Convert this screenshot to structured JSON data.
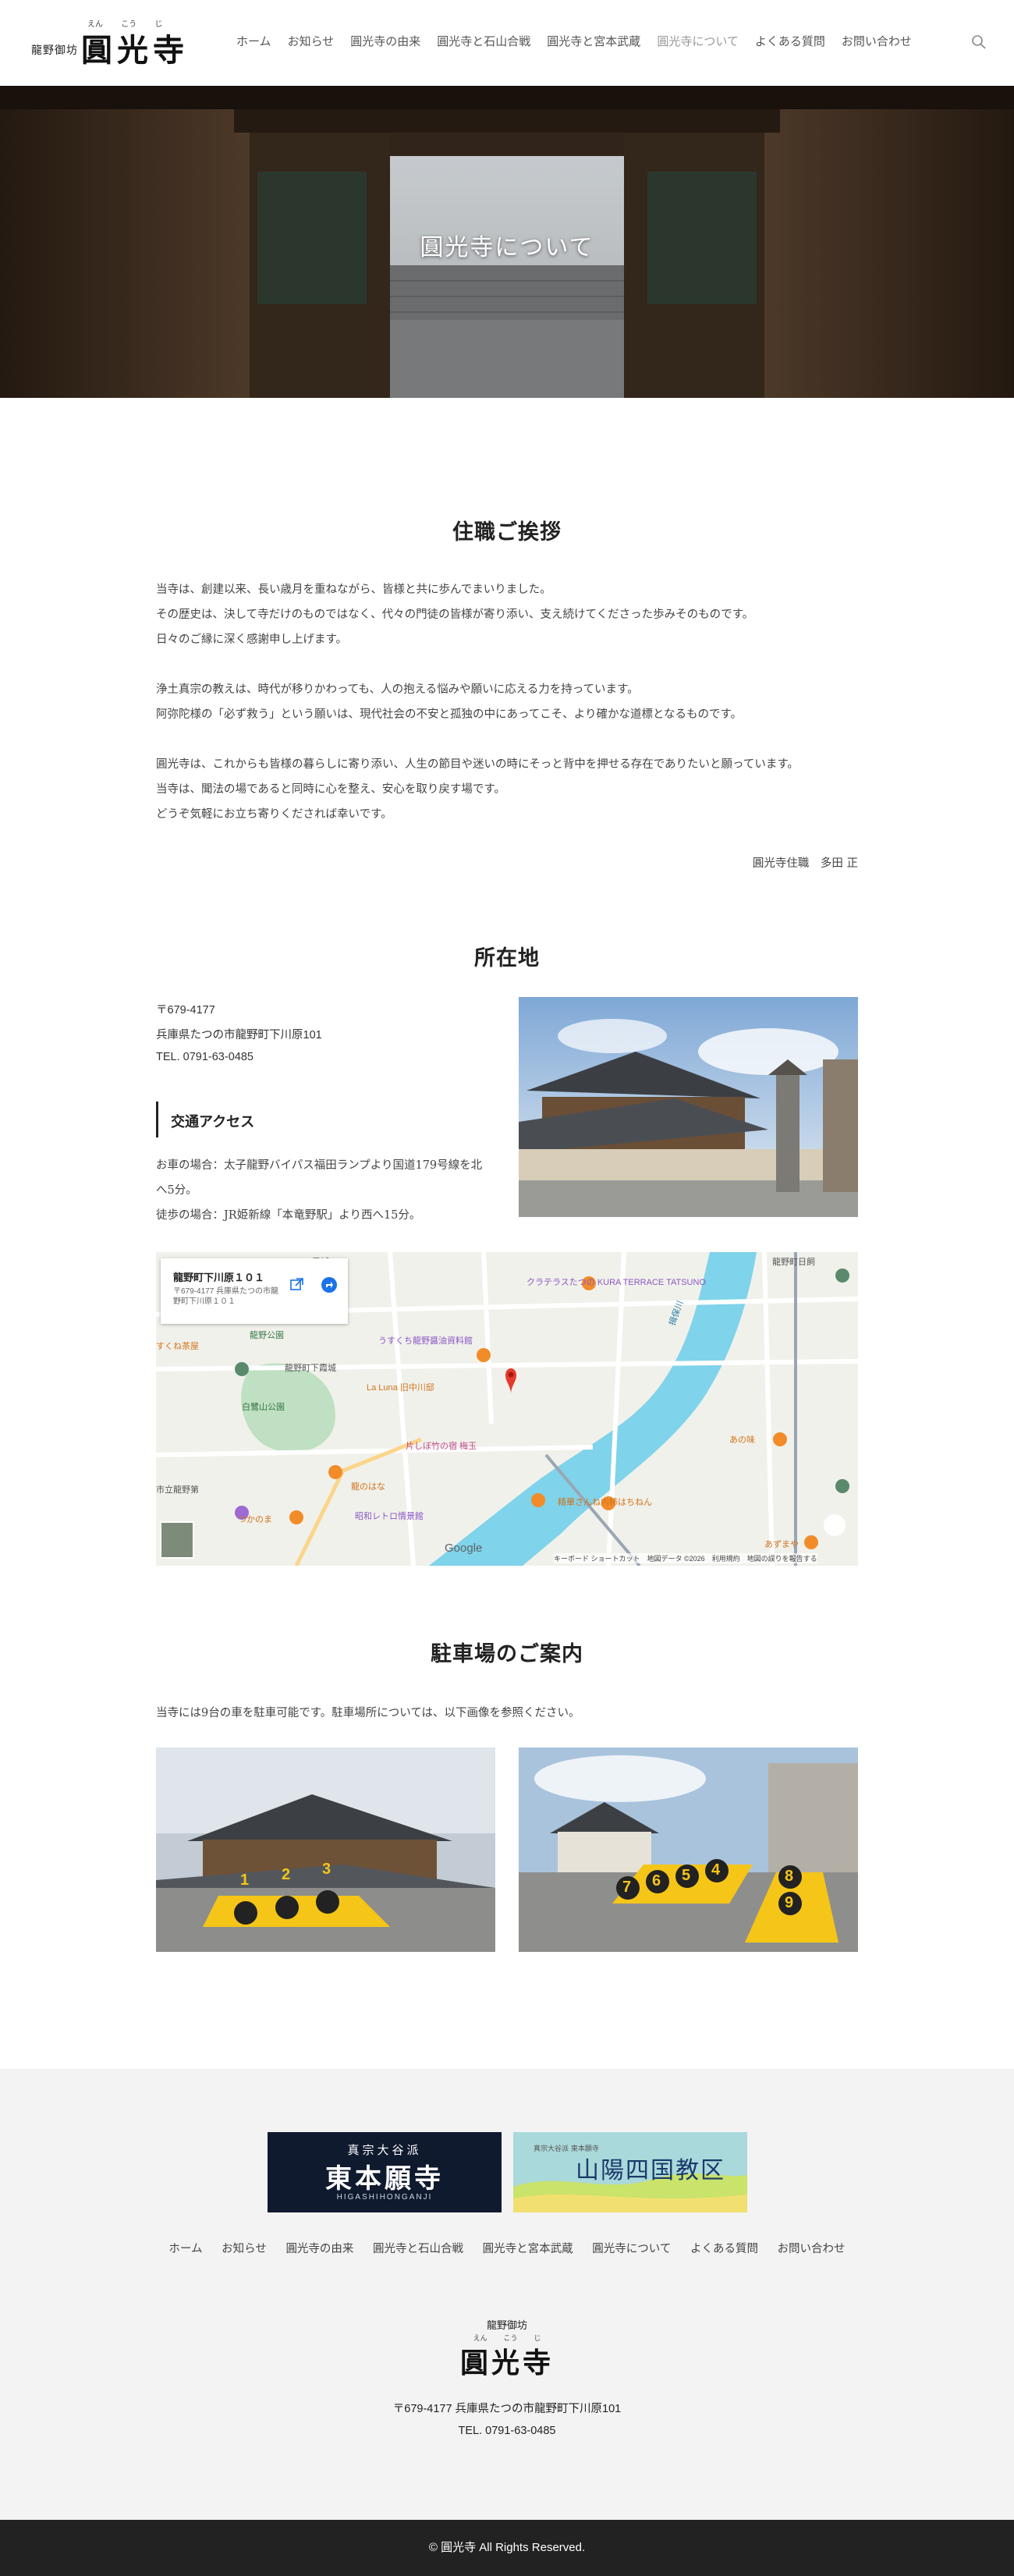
{
  "header": {
    "logo_small": "龍野御坊",
    "logo_big": "圓光寺",
    "logo_ruby": "えん こう じ",
    "nav": [
      "ホーム",
      "お知らせ",
      "圓光寺の由来",
      "圓光寺と石山合戦",
      "圓光寺と宮本武蔵",
      "圓光寺について",
      "よくある質問",
      "お問い合わせ"
    ],
    "active_nav": "圓光寺について"
  },
  "hero": {
    "title": "圓光寺について"
  },
  "greeting": {
    "title": "住職ご挨拶",
    "para1": [
      "当寺は、創建以来、長い歳月を重ねながら、皆様と共に歩んでまいりました。",
      "その歴史は、決して寺だけのものではなく、代々の門徒の皆様が寄り添い、支え続けてくださった歩みそのものです。",
      "日々のご縁に深く感謝申し上げます。"
    ],
    "para2": [
      "浄土真宗の教えは、時代が移りかわっても、人の抱える悩みや願いに応える力を持っています。",
      "阿弥陀様の「必ず救う」という願いは、現代社会の不安と孤独の中にあってこそ、より確かな道標となるものです。"
    ],
    "para3": [
      "圓光寺は、これからも皆様の暮らしに寄り添い、人生の節目や迷いの時にそっと背中を押せる存在でありたいと願っています。",
      "当寺は、聞法の場であると同時に心を整え、安心を取り戻す場です。",
      "どうぞ気軽にお立ち寄りくだされば幸いです。"
    ],
    "signature": "圓光寺住職　多田 正"
  },
  "location": {
    "title": "所在地",
    "postal": "〒679-4177",
    "address": "兵庫県たつの市龍野町下川原101",
    "tel": "TEL. 0791-63-0485",
    "access_heading": "交通アクセス",
    "access_car": "お車の場合：太子龍野バイパス福田ランプより国道179号線を北へ5分。",
    "access_walk": "徒歩の場合：JR姫新線「本竜野駅」より西へ15分。"
  },
  "map": {
    "card_title": "龍野町下川原１０１",
    "card_address": "〒679-4177 兵庫県たつの市龍野町下川原１０１",
    "labels": [
      "クラテラスたつの KURA TERRACE TATSUNO",
      "うすくち龍野醤油資料館",
      "La Luna 旧中川邸",
      "片しぼ竹の宿 梅玉",
      "龍のはな",
      "昭和レトロ情景館",
      "つかのま",
      "霞城",
      "龍野町下霞城",
      "白鷺山公園",
      "龍野公園",
      "すくね茶屋",
      "あの味",
      "精華さんね内柿はちねん",
      "あずまや",
      "龍野町日飼",
      "揖保川",
      "市立龍野第"
    ],
    "footer_text": "キーボード ショートカット　地図データ ©2026　利用規約　地図の誤りを報告する",
    "google": "Google"
  },
  "parking": {
    "title": "駐車場のご案内",
    "text": "当寺には9台の車を駐車可能です。駐車場所については、以下画像を参照ください。",
    "left_spots": [
      "1",
      "2",
      "3"
    ],
    "right_spots": [
      "7",
      "6",
      "5",
      "4",
      "8",
      "9"
    ]
  },
  "footer": {
    "banner1_top": "真宗大谷派",
    "banner1_main": "東本願寺",
    "banner1_sub": "HIGASHIHONGANJI",
    "banner2_top": "真宗大谷派 東本願寺",
    "banner2_main": "山陽四国教区",
    "nav": [
      "ホーム",
      "お知らせ",
      "圓光寺の由来",
      "圓光寺と石山合戦",
      "圓光寺と宮本武蔵",
      "圓光寺について",
      "よくある質問",
      "お問い合わせ"
    ],
    "logo_small": "龍野御坊",
    "logo_ruby": "えん こう じ",
    "logo_big": "圓光寺",
    "address": "〒679-4177 兵庫県たつの市龍野町下川原101",
    "tel": "TEL. 0791-63-0485",
    "copyright": "© 圓光寺 All Rights Reserved."
  },
  "colors": {
    "accent": "#222222",
    "footer_bg": "#f3f3f3",
    "copy_bg": "#222222",
    "parking_marker": "#f5c518"
  }
}
